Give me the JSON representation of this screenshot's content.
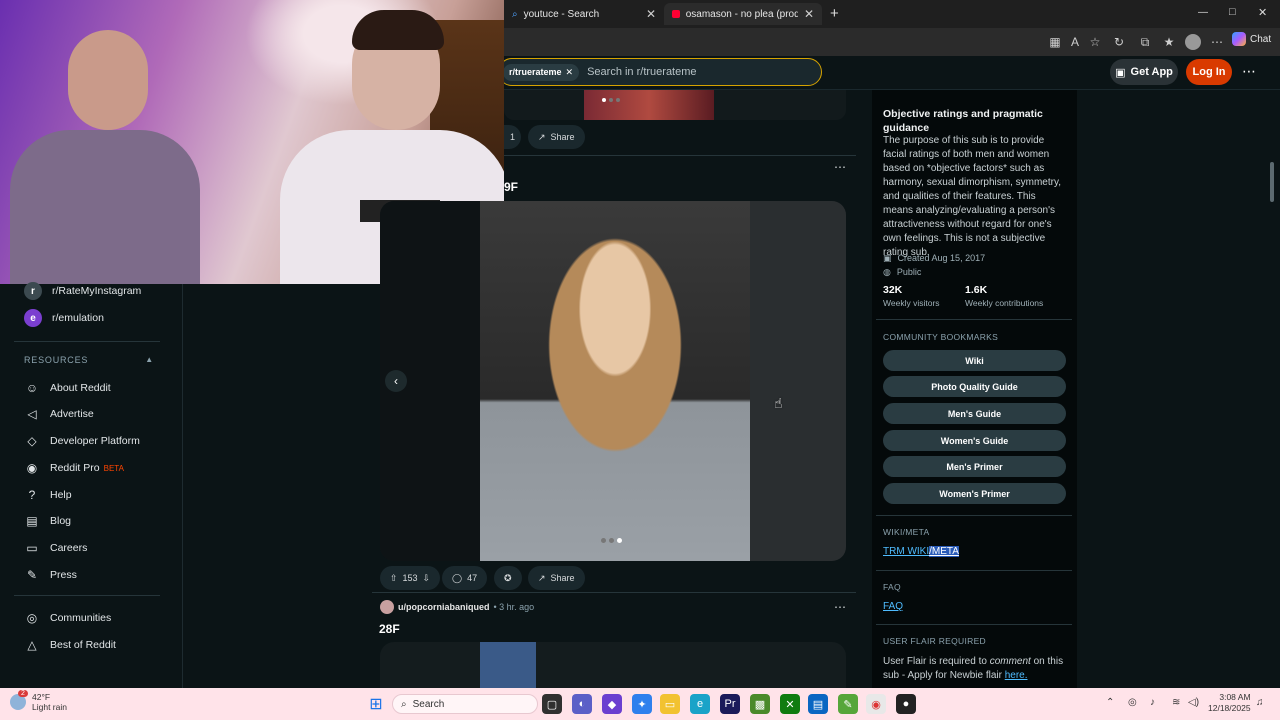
{
  "browser": {
    "tabs": [
      {
        "label": "youtuce - Search",
        "icon": "search-icon"
      },
      {
        "label": "osamason - no plea (prod. boolym...",
        "icon": "youtube-icon"
      }
    ],
    "new_tab": "+",
    "window_controls": {
      "minimize": "—",
      "maximize": "□",
      "close": "✕"
    },
    "chat_label": "Chat"
  },
  "header": {
    "search_chip": "r/truerateme",
    "search_placeholder": "Search in r/truerateme",
    "get_app": "Get App",
    "login": "Log In",
    "more": "⋯"
  },
  "leftnav": {
    "communities": [
      {
        "label": "r/RateMyInstagram",
        "icon": "r"
      },
      {
        "label": "r/emulation",
        "icon": "e"
      }
    ],
    "resources_label": "RESOURCES",
    "resources": [
      {
        "label": "About Reddit",
        "icon": "reddit-icon"
      },
      {
        "label": "Advertise",
        "icon": "megaphone-icon"
      },
      {
        "label": "Developer Platform",
        "icon": "code-icon"
      },
      {
        "label": "Reddit Pro",
        "badge": "BETA",
        "icon": "pro-icon"
      },
      {
        "label": "Help",
        "icon": "help-icon"
      },
      {
        "label": "Blog",
        "icon": "book-icon"
      },
      {
        "label": "Careers",
        "icon": "briefcase-icon"
      },
      {
        "label": "Press",
        "icon": "pen-icon"
      }
    ],
    "bottom": [
      {
        "label": "Communities",
        "icon": "communities-icon"
      },
      {
        "label": "Best of Reddit",
        "icon": "trophy-icon"
      }
    ]
  },
  "feed": {
    "post1": {
      "comments": "1",
      "share": "Share"
    },
    "post2": {
      "title_fragment": "9F",
      "upvotes": "153",
      "comments": "47",
      "share": "Share"
    },
    "post3": {
      "author": "u/popcorniabaniqued",
      "time": "• 3 hr. ago",
      "title": "28F"
    }
  },
  "rightcol": {
    "about_title": "Objective ratings and pragmatic guidance",
    "about_text": "The purpose of this sub is to provide facial ratings of both men and women based on *objective factors* such as harmony, sexual dimorphism, symmetry, and qualities of their features. This means analyzing/evaluating a person's attractiveness without regard for one's own feelings. This is not a subjective rating sub.",
    "created": "Created Aug 15, 2017",
    "visibility": "Public",
    "stats": [
      {
        "value": "32K",
        "label": "Weekly visitors"
      },
      {
        "value": "1.6K",
        "label": "Weekly contributions"
      }
    ],
    "bookmarks_label": "COMMUNITY BOOKMARKS",
    "bookmarks": [
      "Wiki",
      "Photo Quality Guide",
      "Men's Guide",
      "Women's Guide",
      "Men's Primer",
      "Women's Primer"
    ],
    "wiki_label": "WIKI/META",
    "wiki_link_a": "TRM WIKI",
    "wiki_link_b": "/META",
    "faq_label": "FAQ",
    "faq_link": "FAQ",
    "flair_label": "USER FLAIR REQUIRED",
    "flair_text_a": "User Flair is required to ",
    "flair_text_em": "comment",
    "flair_text_b": " on this sub - Apply for Newbie flair ",
    "flair_link": "here."
  },
  "taskbar": {
    "weather_temp": "42°F",
    "weather_desc": "Light rain",
    "weather_badge": "2",
    "search_label": "Search",
    "time": "3:08 AM",
    "date": "12/18/2025"
  },
  "colors": {
    "accent_search_border": "#d6a300",
    "login_button": "#d93a00",
    "taskbar": "#ffe3e9",
    "link": "#4fbcff"
  }
}
